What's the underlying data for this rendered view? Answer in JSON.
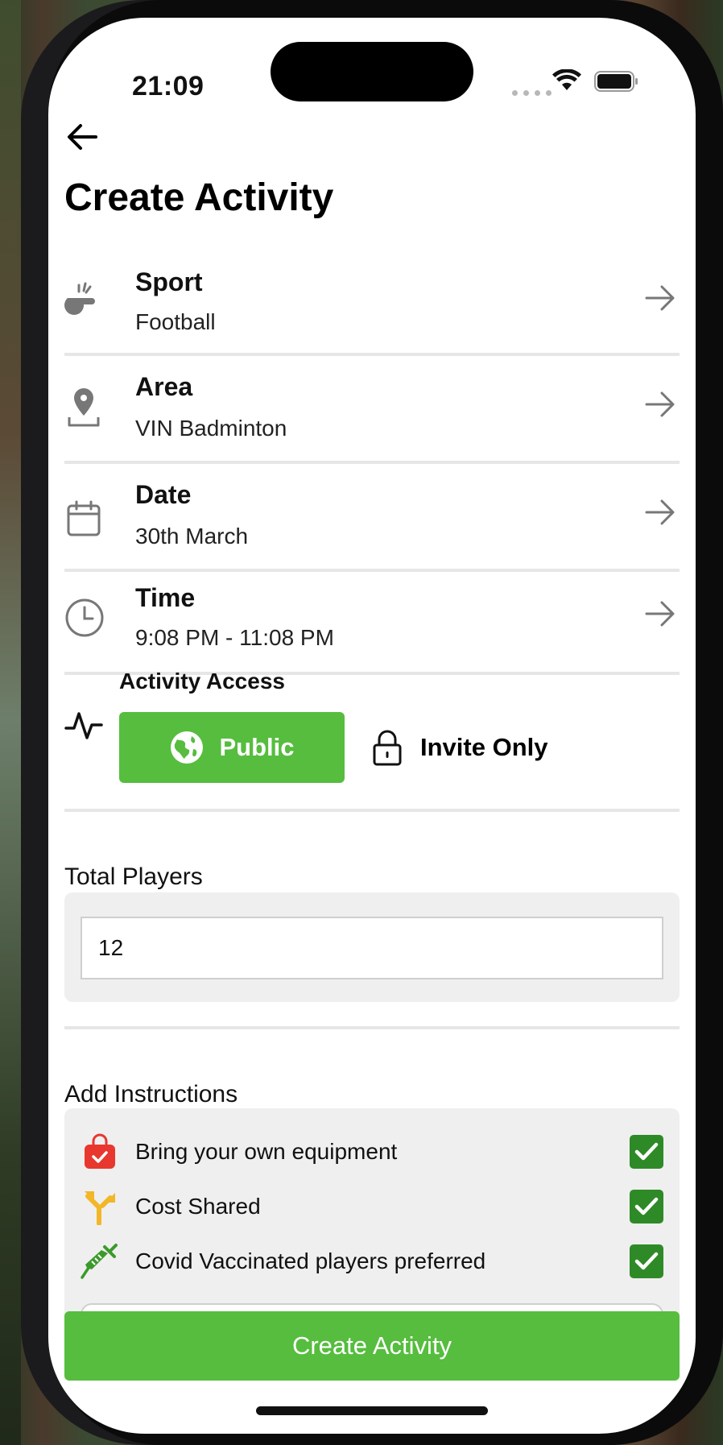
{
  "status": {
    "time": "21:09"
  },
  "page": {
    "title": "Create Activity"
  },
  "rows": [
    {
      "label": "Sport",
      "value": "Football",
      "icon": "whistle-icon"
    },
    {
      "label": "Area",
      "value": "VIN Badminton",
      "icon": "location-pin-icon"
    },
    {
      "label": "Date",
      "value": "30th March",
      "icon": "calendar-icon"
    },
    {
      "label": "Time",
      "value": "9:08 PM - 11:08 PM",
      "icon": "clock-icon"
    }
  ],
  "access": {
    "label": "Activity Access",
    "public": "Public",
    "invite": "Invite Only",
    "selected": "Public"
  },
  "players": {
    "label": "Total Players",
    "value": "12"
  },
  "instructions": {
    "label": "Add Instructions",
    "items": [
      {
        "text": "Bring your own equipment",
        "checked": true,
        "icon": "shopping-bag-icon"
      },
      {
        "text": "Cost Shared",
        "checked": true,
        "icon": "split-arrow-icon"
      },
      {
        "text": "Covid Vaccinated players preferred",
        "checked": true,
        "icon": "syringe-icon"
      }
    ]
  },
  "submit": {
    "label": "Create Activity"
  },
  "colors": {
    "accent": "#56bd3e",
    "check": "#2e8a27",
    "bag": "#e8372e",
    "split": "#f2b728"
  }
}
